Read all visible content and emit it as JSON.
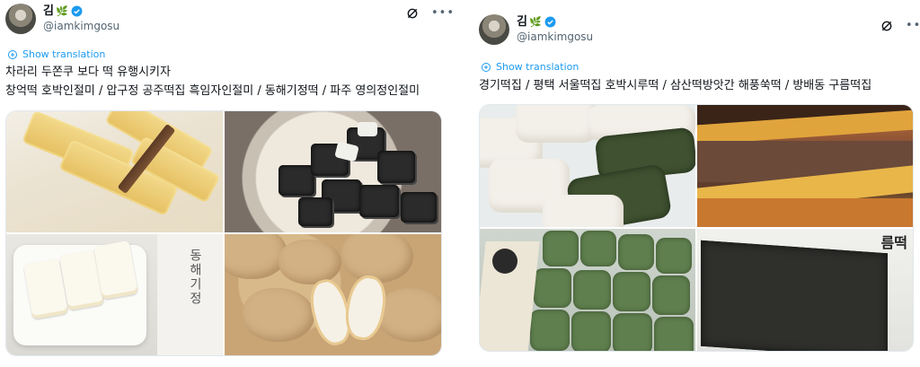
{
  "tweets": [
    {
      "user": {
        "name": "김",
        "emoji": "🌿",
        "handle": "@iamkimgosu"
      },
      "translate_label": "Show translation",
      "text_lines": [
        "차라리 두쫀쿠 보다 떡 유행시키자",
        "창억떡 호박인절미 / 압구정 공주떡집 흑임자인절미 / 동해기정떡 / 파주 영의정인절미"
      ],
      "images": [
        {
          "icon": "injeolmi-photo"
        },
        {
          "icon": "black-sesame-rice-cake-photo"
        },
        {
          "icon": "gijeong-rice-cake-photo",
          "label": "동해기정"
        },
        {
          "icon": "soybean-powder-rice-cake-photo"
        }
      ]
    },
    {
      "user": {
        "name": "김",
        "emoji": "🌿",
        "handle": "@iamkimgosu"
      },
      "translate_label": "Show translation",
      "text_lines": [
        "경기떡집 / 평택 서울떡집 호박시루떡 / 삼산떡방앗간 해풍쑥떡 / 방배동 구름떡집"
      ],
      "images": [
        {
          "icon": "gyeonggi-rice-cake-photo"
        },
        {
          "icon": "pumpkin-sirutteok-photo"
        },
        {
          "icon": "mugwort-rice-cake-photo"
        },
        {
          "icon": "gureum-rice-cake-photo",
          "label": "름떡"
        }
      ]
    }
  ],
  "colors": {
    "link": "#1d9bf0",
    "verified": "#1d9bf0",
    "secondary": "#536471"
  }
}
